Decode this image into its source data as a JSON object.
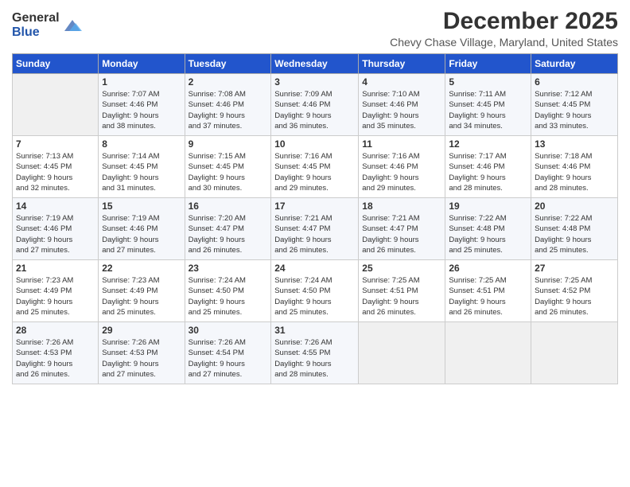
{
  "header": {
    "logo_general": "General",
    "logo_blue": "Blue",
    "title": "December 2025",
    "subtitle": "Chevy Chase Village, Maryland, United States"
  },
  "days_of_week": [
    "Sunday",
    "Monday",
    "Tuesday",
    "Wednesday",
    "Thursday",
    "Friday",
    "Saturday"
  ],
  "weeks": [
    [
      {
        "num": "",
        "lines": []
      },
      {
        "num": "1",
        "lines": [
          "Sunrise: 7:07 AM",
          "Sunset: 4:46 PM",
          "Daylight: 9 hours",
          "and 38 minutes."
        ]
      },
      {
        "num": "2",
        "lines": [
          "Sunrise: 7:08 AM",
          "Sunset: 4:46 PM",
          "Daylight: 9 hours",
          "and 37 minutes."
        ]
      },
      {
        "num": "3",
        "lines": [
          "Sunrise: 7:09 AM",
          "Sunset: 4:46 PM",
          "Daylight: 9 hours",
          "and 36 minutes."
        ]
      },
      {
        "num": "4",
        "lines": [
          "Sunrise: 7:10 AM",
          "Sunset: 4:46 PM",
          "Daylight: 9 hours",
          "and 35 minutes."
        ]
      },
      {
        "num": "5",
        "lines": [
          "Sunrise: 7:11 AM",
          "Sunset: 4:45 PM",
          "Daylight: 9 hours",
          "and 34 minutes."
        ]
      },
      {
        "num": "6",
        "lines": [
          "Sunrise: 7:12 AM",
          "Sunset: 4:45 PM",
          "Daylight: 9 hours",
          "and 33 minutes."
        ]
      }
    ],
    [
      {
        "num": "7",
        "lines": [
          "Sunrise: 7:13 AM",
          "Sunset: 4:45 PM",
          "Daylight: 9 hours",
          "and 32 minutes."
        ]
      },
      {
        "num": "8",
        "lines": [
          "Sunrise: 7:14 AM",
          "Sunset: 4:45 PM",
          "Daylight: 9 hours",
          "and 31 minutes."
        ]
      },
      {
        "num": "9",
        "lines": [
          "Sunrise: 7:15 AM",
          "Sunset: 4:45 PM",
          "Daylight: 9 hours",
          "and 30 minutes."
        ]
      },
      {
        "num": "10",
        "lines": [
          "Sunrise: 7:16 AM",
          "Sunset: 4:45 PM",
          "Daylight: 9 hours",
          "and 29 minutes."
        ]
      },
      {
        "num": "11",
        "lines": [
          "Sunrise: 7:16 AM",
          "Sunset: 4:46 PM",
          "Daylight: 9 hours",
          "and 29 minutes."
        ]
      },
      {
        "num": "12",
        "lines": [
          "Sunrise: 7:17 AM",
          "Sunset: 4:46 PM",
          "Daylight: 9 hours",
          "and 28 minutes."
        ]
      },
      {
        "num": "13",
        "lines": [
          "Sunrise: 7:18 AM",
          "Sunset: 4:46 PM",
          "Daylight: 9 hours",
          "and 28 minutes."
        ]
      }
    ],
    [
      {
        "num": "14",
        "lines": [
          "Sunrise: 7:19 AM",
          "Sunset: 4:46 PM",
          "Daylight: 9 hours",
          "and 27 minutes."
        ]
      },
      {
        "num": "15",
        "lines": [
          "Sunrise: 7:19 AM",
          "Sunset: 4:46 PM",
          "Daylight: 9 hours",
          "and 27 minutes."
        ]
      },
      {
        "num": "16",
        "lines": [
          "Sunrise: 7:20 AM",
          "Sunset: 4:47 PM",
          "Daylight: 9 hours",
          "and 26 minutes."
        ]
      },
      {
        "num": "17",
        "lines": [
          "Sunrise: 7:21 AM",
          "Sunset: 4:47 PM",
          "Daylight: 9 hours",
          "and 26 minutes."
        ]
      },
      {
        "num": "18",
        "lines": [
          "Sunrise: 7:21 AM",
          "Sunset: 4:47 PM",
          "Daylight: 9 hours",
          "and 26 minutes."
        ]
      },
      {
        "num": "19",
        "lines": [
          "Sunrise: 7:22 AM",
          "Sunset: 4:48 PM",
          "Daylight: 9 hours",
          "and 25 minutes."
        ]
      },
      {
        "num": "20",
        "lines": [
          "Sunrise: 7:22 AM",
          "Sunset: 4:48 PM",
          "Daylight: 9 hours",
          "and 25 minutes."
        ]
      }
    ],
    [
      {
        "num": "21",
        "lines": [
          "Sunrise: 7:23 AM",
          "Sunset: 4:49 PM",
          "Daylight: 9 hours",
          "and 25 minutes."
        ]
      },
      {
        "num": "22",
        "lines": [
          "Sunrise: 7:23 AM",
          "Sunset: 4:49 PM",
          "Daylight: 9 hours",
          "and 25 minutes."
        ]
      },
      {
        "num": "23",
        "lines": [
          "Sunrise: 7:24 AM",
          "Sunset: 4:50 PM",
          "Daylight: 9 hours",
          "and 25 minutes."
        ]
      },
      {
        "num": "24",
        "lines": [
          "Sunrise: 7:24 AM",
          "Sunset: 4:50 PM",
          "Daylight: 9 hours",
          "and 25 minutes."
        ]
      },
      {
        "num": "25",
        "lines": [
          "Sunrise: 7:25 AM",
          "Sunset: 4:51 PM",
          "Daylight: 9 hours",
          "and 26 minutes."
        ]
      },
      {
        "num": "26",
        "lines": [
          "Sunrise: 7:25 AM",
          "Sunset: 4:51 PM",
          "Daylight: 9 hours",
          "and 26 minutes."
        ]
      },
      {
        "num": "27",
        "lines": [
          "Sunrise: 7:25 AM",
          "Sunset: 4:52 PM",
          "Daylight: 9 hours",
          "and 26 minutes."
        ]
      }
    ],
    [
      {
        "num": "28",
        "lines": [
          "Sunrise: 7:26 AM",
          "Sunset: 4:53 PM",
          "Daylight: 9 hours",
          "and 26 minutes."
        ]
      },
      {
        "num": "29",
        "lines": [
          "Sunrise: 7:26 AM",
          "Sunset: 4:53 PM",
          "Daylight: 9 hours",
          "and 27 minutes."
        ]
      },
      {
        "num": "30",
        "lines": [
          "Sunrise: 7:26 AM",
          "Sunset: 4:54 PM",
          "Daylight: 9 hours",
          "and 27 minutes."
        ]
      },
      {
        "num": "31",
        "lines": [
          "Sunrise: 7:26 AM",
          "Sunset: 4:55 PM",
          "Daylight: 9 hours",
          "and 28 minutes."
        ]
      },
      {
        "num": "",
        "lines": []
      },
      {
        "num": "",
        "lines": []
      },
      {
        "num": "",
        "lines": []
      }
    ]
  ]
}
